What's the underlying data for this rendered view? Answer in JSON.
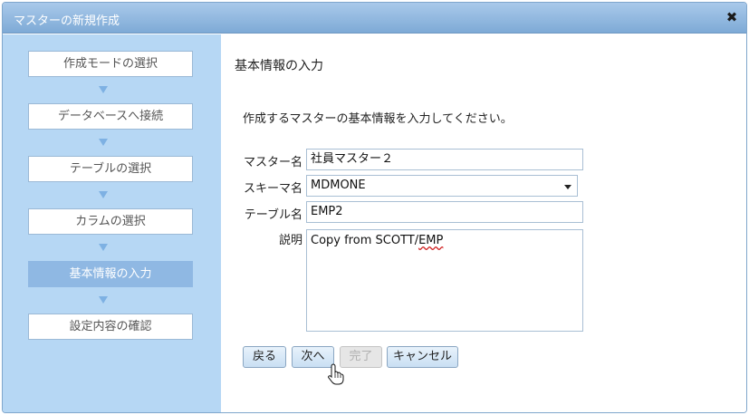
{
  "dialog": {
    "title": "マスターの新規作成",
    "close_glyph": "✖"
  },
  "steps": [
    {
      "label": "作成モードの選択",
      "active": false
    },
    {
      "label": "データベースへ接続",
      "active": false
    },
    {
      "label": "テーブルの選択",
      "active": false
    },
    {
      "label": "カラムの選択",
      "active": false
    },
    {
      "label": "基本情報の入力",
      "active": true
    },
    {
      "label": "設定内容の確認",
      "active": false
    }
  ],
  "content": {
    "section_title": "基本情報の入力",
    "instruction": "作成するマスターの基本情報を入力してください。"
  },
  "form": {
    "master_name_label": "マスター名",
    "master_name_value": "社員マスター２",
    "schema_label": "スキーマ名",
    "schema_value": "MDMONE",
    "table_label": "テーブル名",
    "table_value": "EMP2",
    "description_label": "説明",
    "description_prefix": "Copy from SCOTT/",
    "description_flagged": "EMP"
  },
  "buttons": {
    "back": "戻る",
    "next": "次へ",
    "finish": "完了",
    "cancel": "キャンセル"
  },
  "colors": {
    "titlebar": "#7eaad6",
    "sidebar": "#b6d7f4",
    "active_step": "#8fb8e3"
  }
}
